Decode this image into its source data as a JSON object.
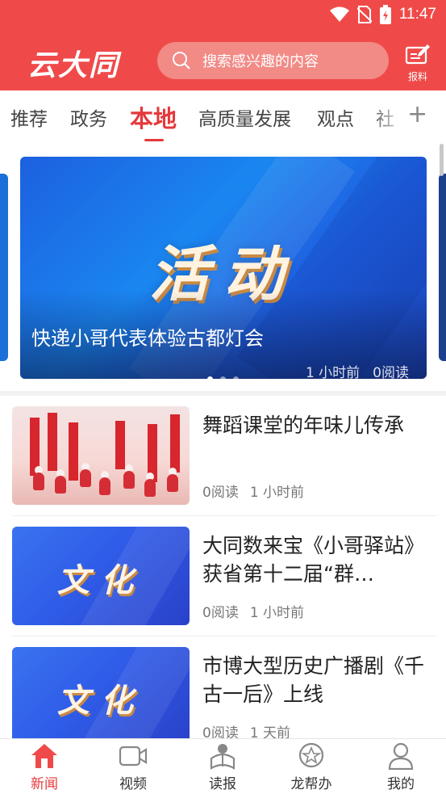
{
  "status_bar": {
    "time": "11:47"
  },
  "app_bar": {
    "logo_text": "云大同",
    "search_placeholder": "搜索感兴趣的内容",
    "report_label": "报料"
  },
  "tabs": [
    {
      "label": "推荐"
    },
    {
      "label": "政务"
    },
    {
      "label": "本地",
      "active": true
    },
    {
      "label": "高质量发展"
    },
    {
      "label": "观点"
    },
    {
      "label": "社"
    }
  ],
  "tab_add_label": "+",
  "banner": {
    "image_word": "活动",
    "title": "快递小哥代表体验古都灯会",
    "time": "1 小时前",
    "reads": "0阅读",
    "page_count": 3,
    "current_page": 1
  },
  "news": [
    {
      "title": "舞蹈课堂的年味儿传承",
      "reads": "0阅读",
      "time": "1 小时前",
      "thumb": "dance-photo"
    },
    {
      "title": "大同数来宝《小哥驿站》获省第十二届“群…",
      "reads": "0阅读",
      "time": "1 小时前",
      "thumb": "culture",
      "thumb_word": "文化"
    },
    {
      "title": "市博大型历史广播剧《千古一后》上线",
      "reads": "0阅读",
      "time": "1 天前",
      "thumb": "culture",
      "thumb_word": "文化"
    }
  ],
  "bottom_nav": [
    {
      "label": "新闻",
      "icon": "home-icon",
      "active": true
    },
    {
      "label": "视频",
      "icon": "video-icon"
    },
    {
      "label": "读报",
      "icon": "newspaper-reader-icon"
    },
    {
      "label": "龙帮办",
      "icon": "service-badge-icon"
    },
    {
      "label": "我的",
      "icon": "profile-icon"
    }
  ],
  "colors": {
    "brand": "#ef4a49",
    "active_tab": "#e5393b"
  }
}
